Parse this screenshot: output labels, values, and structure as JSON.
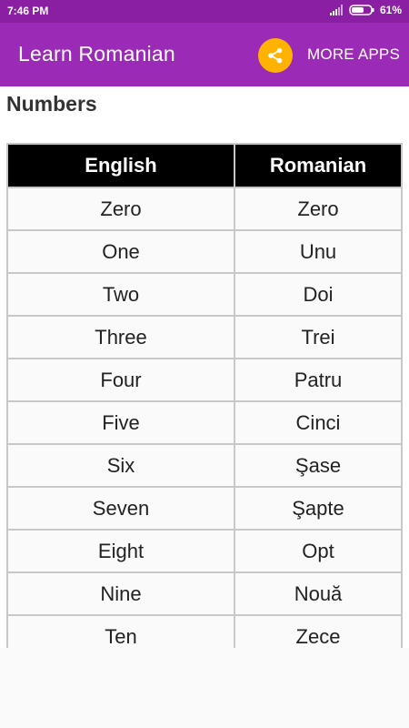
{
  "status_bar": {
    "time": "7:46 PM",
    "battery": "61%",
    "signal_icon": "signal-icon",
    "battery_icon": "battery-icon"
  },
  "app_bar": {
    "title": "Learn Romanian",
    "share_icon": "share-icon",
    "more_apps_label": "MORE APPS",
    "background_color": "#9b2bb6",
    "share_button_color": "#ffb300"
  },
  "section": {
    "title": "Numbers"
  },
  "table": {
    "headers": [
      "English",
      "Romanian"
    ],
    "rows": [
      [
        "Zero",
        "Zero"
      ],
      [
        "One",
        "Unu"
      ],
      [
        "Two",
        "Doi"
      ],
      [
        "Three",
        "Trei"
      ],
      [
        "Four",
        "Patru"
      ],
      [
        "Five",
        "Cinci"
      ],
      [
        "Six",
        "Şase"
      ],
      [
        "Seven",
        "Şapte"
      ],
      [
        "Eight",
        "Opt"
      ],
      [
        "Nine",
        "Nouă"
      ],
      [
        "Ten",
        "Zece"
      ]
    ]
  }
}
